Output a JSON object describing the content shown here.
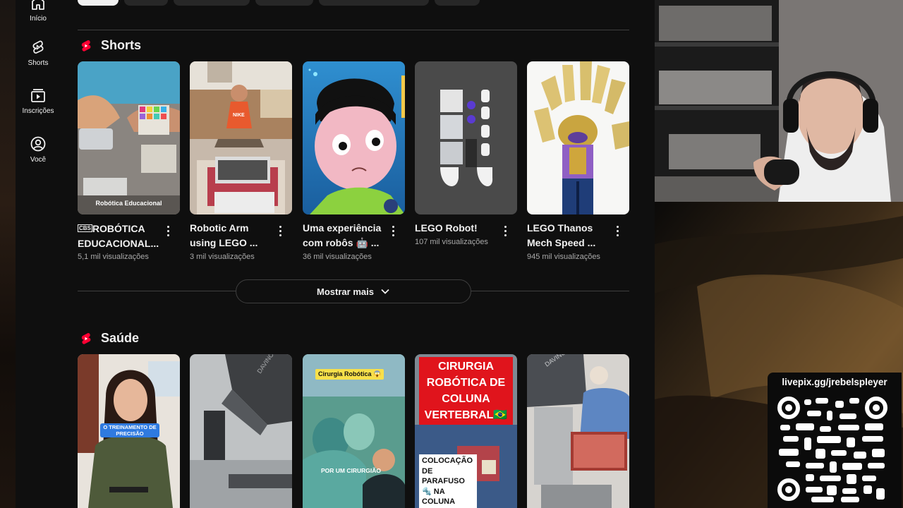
{
  "nav": {
    "items": [
      {
        "label": "Início",
        "icon": "home-icon"
      },
      {
        "label": "Shorts",
        "icon": "shorts-icon"
      },
      {
        "label": "Inscrições",
        "icon": "subscriptions-icon"
      },
      {
        "label": "Você",
        "icon": "account-icon"
      }
    ]
  },
  "sections": {
    "shorts": {
      "title": "Shorts",
      "cards": [
        {
          "title": "ROBÓTICA EDUCACIONAL...",
          "badge": "CBS",
          "views": "5,1 mil visualizações",
          "overlay": "Robótica Educacional"
        },
        {
          "title": "Robotic Arm using LEGO ...",
          "views": "3 mil visualizações"
        },
        {
          "title": "Uma experiência com robôs 🤖 ...",
          "views": "36 mil visualizações"
        },
        {
          "title": "LEGO Robot!",
          "views": "107 mil visualizações"
        },
        {
          "title": "LEGO Thanos Mech Speed ...",
          "views": "945 mil visualizações"
        }
      ]
    },
    "saude": {
      "title": "Saúde",
      "cards": [
        {
          "overlay": "O TREINAMENTO DE PRECISÃO"
        },
        {
          "overlay": "DAVINCI"
        },
        {
          "overlay_top": "Cirurgia Robótica 😱",
          "overlay_bottom": "POR UM CIRURGIÃO"
        },
        {
          "overlay_top": "CIRURGIA ROBÓTICA DE COLUNA VERTEBRAL🇧🇷",
          "overlay_bottom": "COLOCAÇÃO DE PARAFUSO 🔩 NA COLUNA LOMBAR"
        },
        {
          "overlay": "DAVINCI"
        }
      ]
    }
  },
  "show_more": {
    "label": "Mostrar mais"
  },
  "stream": {
    "qr_label": "livepix.gg/jrebelspleyer"
  },
  "colors": {
    "yt_bg": "#0f0f0f",
    "shorts_red": "#ff0033",
    "muted_text": "#aaaaaa"
  }
}
